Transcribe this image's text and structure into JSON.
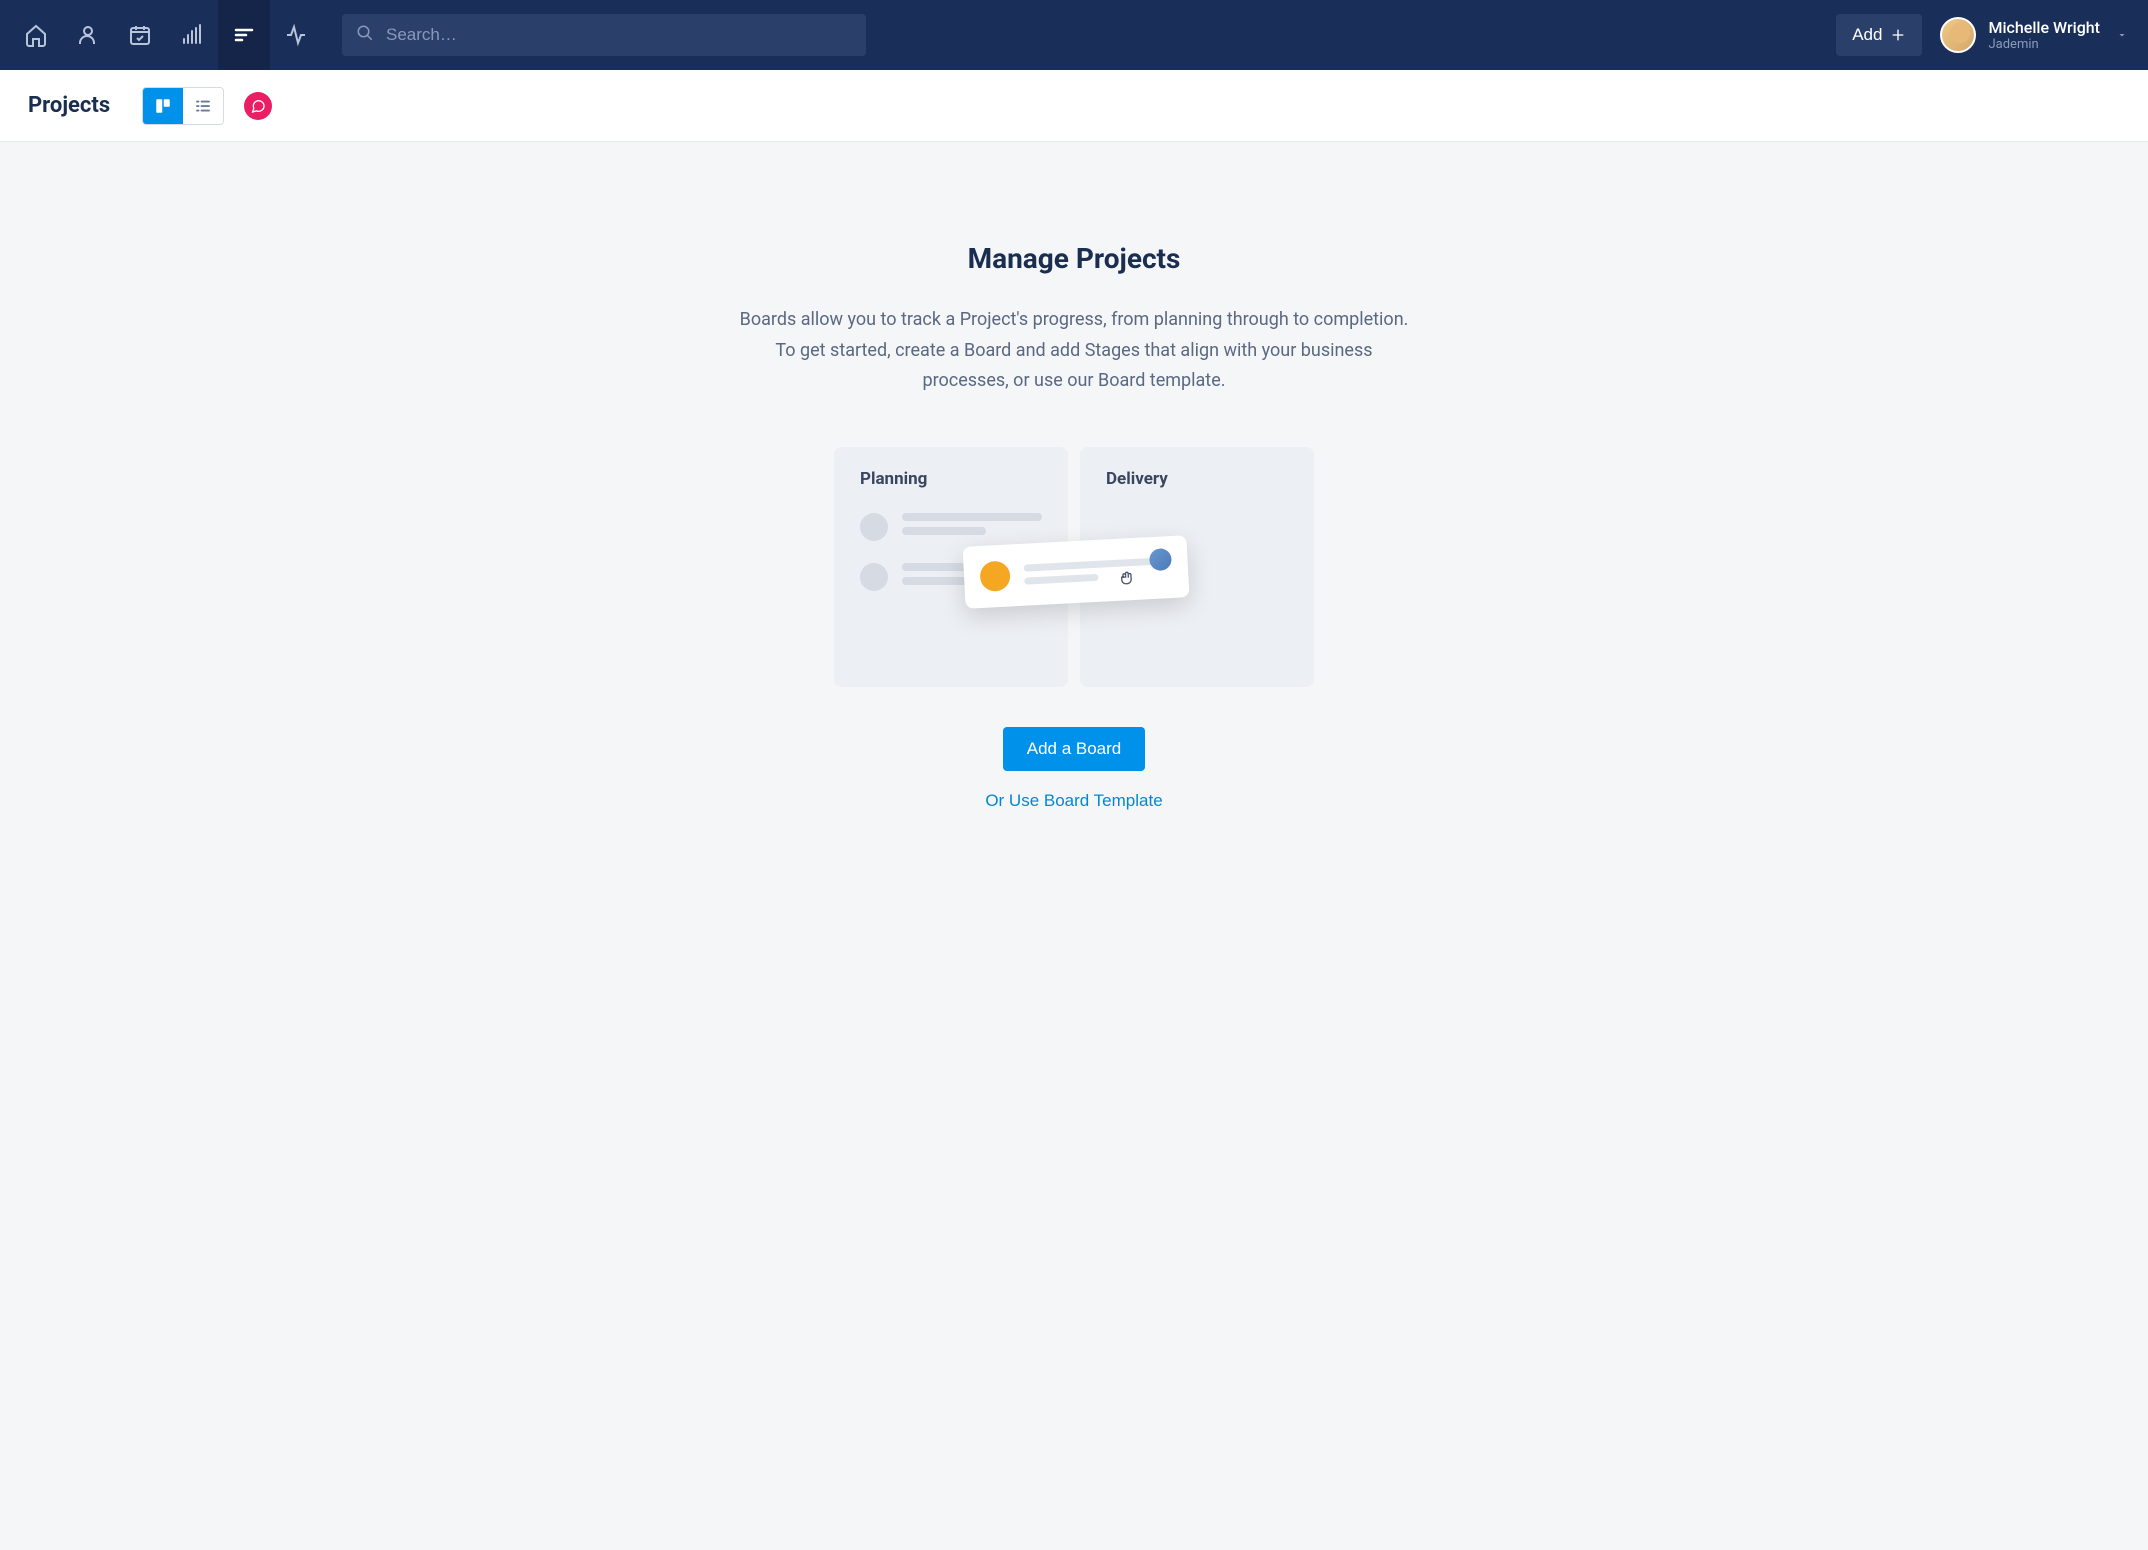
{
  "header": {
    "search_placeholder": "Search…",
    "add_label": "Add",
    "user": {
      "name": "Michelle Wright",
      "org": "Jademin"
    }
  },
  "subheader": {
    "page_title": "Projects"
  },
  "main": {
    "title": "Manage Projects",
    "description": "Boards allow you to track a Project's progress, from planning through to completion. To get started, create a Board and add Stages that align with your business processes, or use our Board template.",
    "illustration": {
      "col1_title": "Planning",
      "col2_title": "Delivery"
    },
    "primary_button": "Add a Board",
    "secondary_link": "Or Use Board Template"
  }
}
